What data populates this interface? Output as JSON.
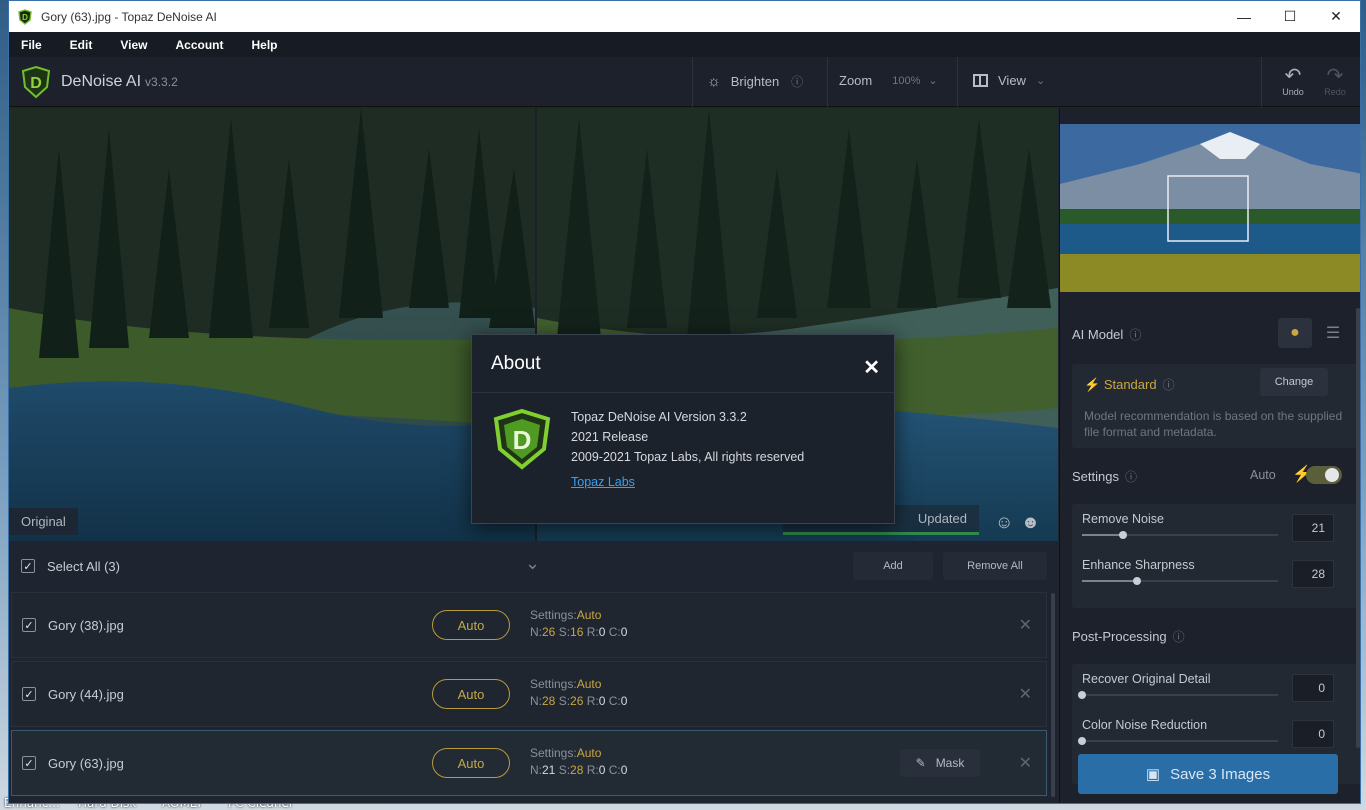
{
  "window": {
    "title": "Gory (63).jpg - Topaz DeNoise AI"
  },
  "desktop": {
    "icons": [
      "Enhanc...",
      "Hard Disk",
      "AOMEI",
      "PC Cleaner"
    ]
  },
  "menu": {
    "items": [
      "File",
      "Edit",
      "View",
      "Account",
      "Help"
    ]
  },
  "toolbar": {
    "app_name": "DeNoise AI",
    "version": "v3.3.2",
    "brighten": "Brighten",
    "zoom_label": "Zoom",
    "zoom_value": "100%",
    "view_label": "View",
    "undo": "Undo",
    "redo": "Redo"
  },
  "preview": {
    "left_badge": "Original",
    "right_badge": "Updated"
  },
  "about": {
    "title": "About",
    "line1": "Topaz DeNoise AI Version 3.3.2",
    "line2": "2021 Release",
    "line3": "2009-2021 Topaz Labs, All rights reserved",
    "link": "Topaz Labs"
  },
  "list": {
    "select_all": "Select All (3)",
    "add": "Add",
    "remove_all": "Remove All",
    "rows": [
      {
        "name": "Gory (38).jpg",
        "auto": "Auto",
        "settings_label": "Settings:",
        "settings_value": "Auto",
        "n": "26",
        "s": "16",
        "r": "0",
        "c": "0"
      },
      {
        "name": "Gory (44).jpg",
        "auto": "Auto",
        "settings_label": "Settings:",
        "settings_value": "Auto",
        "n": "28",
        "s": "26",
        "r": "0",
        "c": "0"
      },
      {
        "name": "Gory (63).jpg",
        "auto": "Auto",
        "settings_label": "Settings:",
        "settings_value": "Auto",
        "n": "21",
        "s": "28",
        "r": "0",
        "c": "0",
        "mask": "Mask"
      }
    ]
  },
  "panel": {
    "ai_model": "AI Model",
    "model_name": "Standard",
    "change": "Change",
    "recommendation": "Model recommendation is based on the supplied file format and metadata.",
    "settings": "Settings",
    "auto": "Auto",
    "remove_noise_label": "Remove Noise",
    "remove_noise_value": "21",
    "remove_noise_level": 0.21,
    "enhance_sharpness_label": "Enhance Sharpness",
    "enhance_sharpness_value": "28",
    "enhance_sharpness_level": 0.28,
    "post_processing": "Post-Processing",
    "recover_detail_label": "Recover Original Detail",
    "recover_detail_value": "0",
    "recover_detail_level": 0,
    "color_noise_label": "Color Noise Reduction",
    "color_noise_value": "0",
    "color_noise_level": 0,
    "save": "Save 3 Images"
  },
  "colors": {
    "accent_yellow": "#c9a640",
    "save_blue": "#2a6ea8",
    "link_blue": "#3ba0f0"
  }
}
